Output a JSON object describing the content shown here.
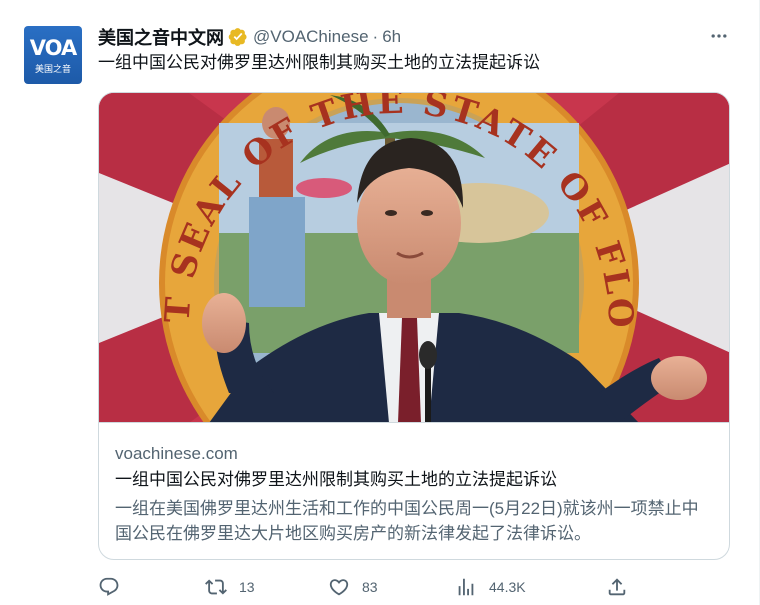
{
  "account": {
    "display_name": "美国之音中文网",
    "handle": "@VOAChinese",
    "separator": "·",
    "time": "6h",
    "avatar_logo": "VOA",
    "avatar_sub": "美国之音",
    "verified_color": "#e8b923"
  },
  "tweet": {
    "text": "一组中国公民对佛罗里达州限制其购买土地的立法提起诉讼"
  },
  "card": {
    "domain": "voachinese.com",
    "title": "一组中国公民对佛罗里达州限制其购买土地的立法提起诉讼",
    "description": "一组在美国佛罗里达州生活和工作的中国公民周一(5月22日)就该州一项禁止中国公民在佛罗里达大片地区购买房产的新法律发起了法律诉讼。",
    "image_seal_text": "GREAT SEAL OF THE STATE OF FLORIDA"
  },
  "actions": {
    "reply_icon": "reply-icon",
    "retweet_icon": "retweet-icon",
    "retweet_count": "13",
    "like_icon": "like-icon",
    "like_count": "83",
    "views_icon": "views-icon",
    "views_count": "44.3K",
    "share_icon": "share-icon"
  },
  "colors": {
    "text_primary": "#0f1419",
    "text_secondary": "#536471",
    "border": "#cfd9de",
    "flag_red": "#c8364d"
  }
}
